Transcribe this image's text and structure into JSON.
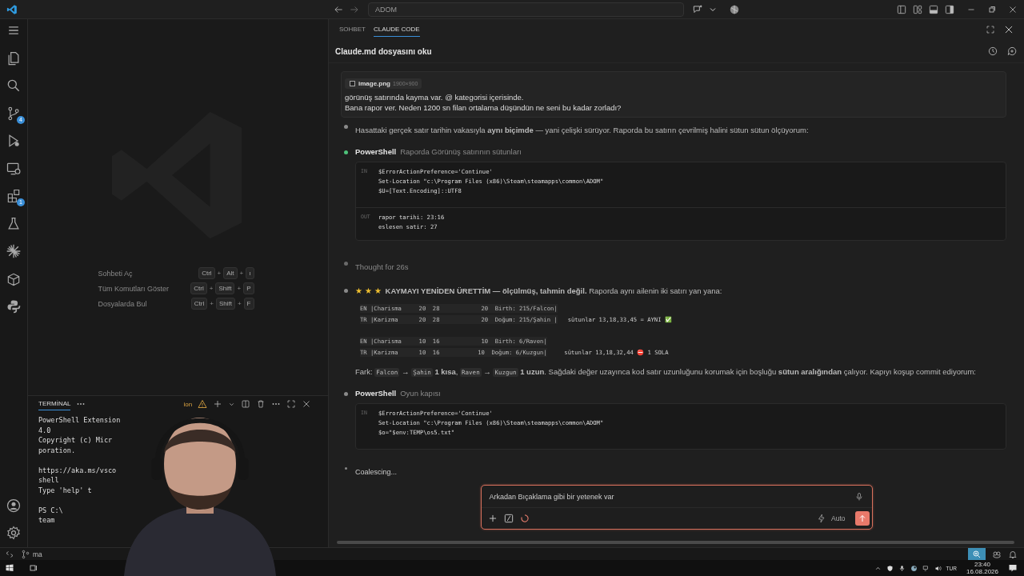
{
  "title_bar": {
    "search": "ADOM"
  },
  "activity_bar": {
    "items": [
      {
        "kind": "menu"
      },
      {
        "kind": "files"
      },
      {
        "kind": "search"
      },
      {
        "kind": "branch",
        "badge": "4"
      },
      {
        "kind": "run"
      },
      {
        "kind": "monitor"
      },
      {
        "kind": "extensions",
        "badge": "1"
      },
      {
        "kind": "flask"
      },
      {
        "kind": "starburst"
      },
      {
        "kind": "box"
      },
      {
        "kind": "snakes"
      }
    ],
    "bottom": [
      {
        "kind": "account"
      },
      {
        "kind": "settings"
      }
    ]
  },
  "editor": {
    "shortcuts": [
      {
        "label": "Sohbeti Aç",
        "keys": [
          {
            "kind": "key",
            "text": "Ctrl"
          },
          {
            "kind": "plus",
            "text": "+"
          },
          {
            "kind": "key",
            "text": "Alt"
          },
          {
            "kind": "plus",
            "text": "+"
          },
          {
            "kind": "key",
            "text": "ı"
          }
        ]
      },
      {
        "label": "Tüm Komutları Göster",
        "keys": [
          {
            "kind": "key",
            "text": "Ctrl"
          },
          {
            "kind": "plus",
            "text": "+"
          },
          {
            "kind": "key",
            "text": "Shift"
          },
          {
            "kind": "plus",
            "text": "+"
          },
          {
            "kind": "key",
            "text": "P"
          }
        ]
      },
      {
        "label": "Dosyalarda Bul",
        "keys": [
          {
            "kind": "key",
            "text": "Ctrl"
          },
          {
            "kind": "plus",
            "text": "+"
          },
          {
            "kind": "key",
            "text": "Shift"
          },
          {
            "kind": "plus",
            "text": "+"
          },
          {
            "kind": "key",
            "text": "F"
          }
        ]
      }
    ]
  },
  "terminal": {
    "tab": "TERMİNAL",
    "profile": "ion",
    "paragraphs": [
      [
        "PowerShell Extension",
        "4.0",
        "Copyright (c) Micr",
        "poration."
      ],
      [
        "https://aka.ms/vsco",
        "shell",
        "Type 'help' t"
      ],
      [
        "PS C:\\",
        "team"
      ]
    ]
  },
  "status_bar": {
    "branch": "ma"
  },
  "chat": {
    "tabs": [
      {
        "label": "SOHBET",
        "selected": false
      },
      {
        "label": "CLAUDE CODE",
        "selected": true
      }
    ],
    "title": "Claude.md dosyasını oku",
    "user_message": {
      "attachment": {
        "name": "image.png",
        "size": "1900×900"
      },
      "lines": [
        "görünüş satırında kayma var. @ kategorisi içerisinde.",
        "Bana rapor ver. Neden 1200 sn filan ortalama düşündün ne seni bu kadar zorladı?"
      ]
    },
    "timeline": [
      {
        "kind": "text",
        "color": "#8a8a8a",
        "text": "Hasattaki gerçek satır tarihin vakasıyla **aynı biçimde** — yani çelişki sürüyor. Raporda bu satırın çevrilmiş halini sütun sütun ölçüyorum:"
      },
      {
        "kind": "tool",
        "color": "#4ec27a",
        "name": "PowerShell",
        "description": "Raporda Görünüş satırının sütunları",
        "blocks": [
          {
            "label": "IN",
            "lines": [
              "$ErrorActionPreference='Continue'",
              "Set-Location \"c:\\Program Files (x86)\\Steam\\steamapps\\common\\ADOM\"",
              "$U=[Text.Encoding]::UTF8"
            ]
          },
          {
            "label": "OUT",
            "lines": [
              "rapor tarihi: 23:16",
              "eslesen satir: 27"
            ]
          }
        ]
      },
      {
        "kind": "thought",
        "color": "#6a6a6a",
        "text": "Thought for 26s"
      },
      {
        "kind": "table",
        "color": "#8a8a8a",
        "stars_text": "★ ★ ★",
        "text": "**KAYMAYI YENİDEN ÜRETTİM — ölçülmüş, tahmin değil.** Raporda aynı ailenin iki satırı yan yana:",
        "groups": [
          [
            {
              "code": "EN |Charisma     20  28            20  Birth: 215/Falcon|"
            },
            {
              "code": "TR |Karizma      20  28            20  Doğum: 215/Şahin |",
              "note": "   sütunlar 13,18,33,45 = AYNI ✅"
            }
          ],
          [
            {
              "code": "EN |Charisma     10  16            10  Birth: 6/Raven|"
            },
            {
              "code": "TR |Karizma      10  16           10  Doğum: 6/Kuzgun|",
              "note": "     sütunlar 13,18,32,44 ⛔ 1 SOLA"
            }
          ]
        ],
        "segments": [
          {
            "kind": "text",
            "text": "Fark: "
          },
          {
            "kind": "code",
            "text": "Falcon"
          },
          {
            "kind": "text",
            "text": " → "
          },
          {
            "kind": "code",
            "text": "Şahin"
          },
          {
            "kind": "text",
            "text": " **1 kısa**, "
          },
          {
            "kind": "code",
            "text": "Raven"
          },
          {
            "kind": "text",
            "text": " → "
          },
          {
            "kind": "code",
            "text": "Kuzgun"
          },
          {
            "kind": "text",
            "text": " **1 uzun**. Sağdaki değer uzayınca kod satır uzunluğunu korumak için boşluğu **sütun aralığından** çalıyor. Kapıyı koşup commit ediyorum:"
          }
        ]
      },
      {
        "kind": "tool",
        "color": "#8a8a8a",
        "name": "PowerShell",
        "description": "Oyun kapısı",
        "blocks": [
          {
            "label": "IN",
            "lines": [
              "$ErrorActionPreference='Continue'",
              "Set-Location \"c:\\Program Files (x86)\\Steam\\steamapps\\common\\ADOM\"",
              "$o=\"$env:TEMP\\os5.txt\""
            ]
          }
        ]
      },
      {
        "kind": "status",
        "color": "#8a8a8a",
        "text": "Coalescing..."
      }
    ],
    "input": {
      "value": "Arkadan Bıçaklama gibi bir yetenek var",
      "mode": "Auto"
    }
  },
  "taskbar": {
    "language": "TUR",
    "time": "23:40",
    "date": "16.08.2026"
  }
}
